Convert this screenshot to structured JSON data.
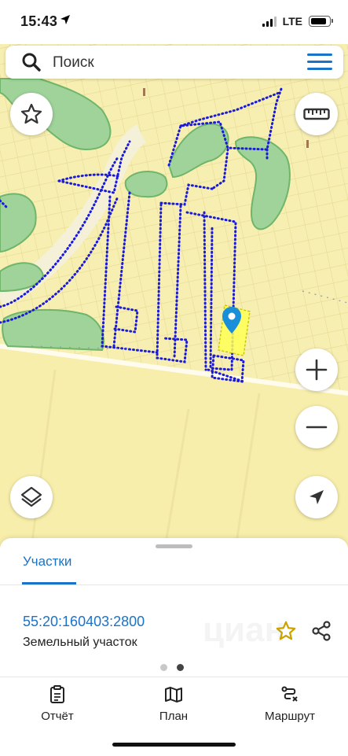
{
  "status_bar": {
    "time": "15:43",
    "network": "LTE"
  },
  "search": {
    "placeholder": "Поиск"
  },
  "map": {
    "controls": [
      "star-icon",
      "ruler-icon",
      "zoom-in-icon",
      "zoom-out-icon",
      "layers-icon",
      "location-arrow-icon"
    ]
  },
  "sheet": {
    "tab_label": "Участки",
    "parcel": {
      "number": "55:20:160403:2800",
      "type": "Земельный участок"
    },
    "watermark": "циан",
    "pagination": {
      "current": 2,
      "total": 2
    }
  },
  "bottom_nav": {
    "items": [
      {
        "label": "Отчёт",
        "icon": "report-icon"
      },
      {
        "label": "План",
        "icon": "map-plan-icon"
      },
      {
        "label": "Маршрут",
        "icon": "route-icon"
      }
    ]
  },
  "colors": {
    "accent": "#1a73c9",
    "parcel_boundary": "#1a1adb",
    "selected_parcel": "#ffff55",
    "forest": "#9fd39a",
    "map_background": "#f6efb0",
    "star": "#c9a400"
  }
}
